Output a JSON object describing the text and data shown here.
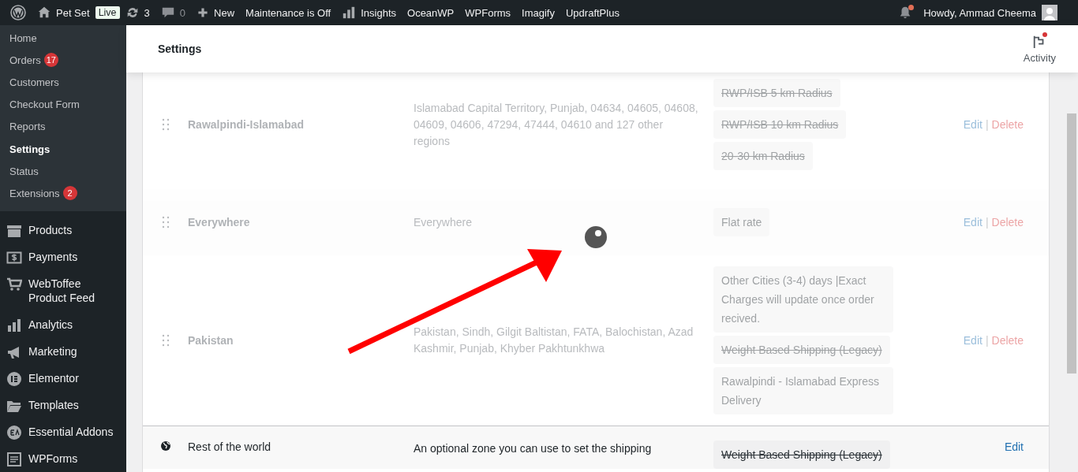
{
  "admin_bar": {
    "site": "Pet Set",
    "badge": "Live",
    "updates": "3",
    "comments": "0",
    "new": "New",
    "items": [
      "Maintenance is Off",
      "Insights",
      "OceanWP",
      "WPForms",
      "Imagify",
      "UpdraftPlus"
    ],
    "notification_dot": true,
    "greeting": "Howdy, Ammad Cheema"
  },
  "sidebar": {
    "submenu": [
      {
        "label": "Home",
        "selected": false
      },
      {
        "label": "Orders",
        "selected": false,
        "count": "17"
      },
      {
        "label": "Customers",
        "selected": false
      },
      {
        "label": "Checkout Form",
        "selected": false
      },
      {
        "label": "Reports",
        "selected": false
      },
      {
        "label": "Settings",
        "selected": true
      },
      {
        "label": "Status",
        "selected": false
      },
      {
        "label": "Extensions",
        "selected": false,
        "count": "2"
      }
    ],
    "menu": [
      "Products",
      "Payments",
      "WebToffee Product Feed",
      "Analytics",
      "Marketing",
      "Elementor",
      "Templates",
      "Essential Addons",
      "WPForms"
    ]
  },
  "header": {
    "title": "Settings",
    "activity": "Activity",
    "activity_dot": true
  },
  "zones": [
    {
      "kind": "zone",
      "name": "Rawalpindi-Islamabad",
      "dimmed": true,
      "regions": "Islamabad Capital Territory, Punjab, 04634, 04605, 04608, 04609, 04606, 47294, 47444, 04610 and 127 other regions",
      "methods": [
        {
          "label": "RWP/ISB 5 km Radius",
          "enabled": false
        },
        {
          "label": "RWP/ISB 10 km Radius",
          "enabled": false
        },
        {
          "label": "20-30 km Radius",
          "enabled": false
        }
      ],
      "actions": [
        {
          "label": "Edit",
          "kind": "edit"
        },
        {
          "label": "|",
          "kind": "separator"
        },
        {
          "label": "Delete",
          "kind": "delete"
        }
      ]
    },
    {
      "kind": "zone",
      "name": "Everywhere",
      "dimmed": true,
      "regions": "Everywhere",
      "methods": [
        {
          "label": "Flat rate",
          "enabled": true
        }
      ],
      "actions": [
        {
          "label": "Edit",
          "kind": "edit"
        },
        {
          "label": "|",
          "kind": "separator"
        },
        {
          "label": "Delete",
          "kind": "delete"
        }
      ]
    },
    {
      "kind": "zone",
      "name": "Pakistan",
      "dimmed": true,
      "regions": "Pakistan, Sindh, Gilgit Baltistan, FATA, Balochistan, Azad Kashmir, Punjab, Khyber Pakhtunkhwa",
      "methods": [
        {
          "label": "Other Cities (3-4) days |Exact Charges will update once order recived.",
          "enabled": true
        },
        {
          "label": "Weight Based Shipping (Legacy)",
          "enabled": false
        },
        {
          "label": "Rawalpindi - Islamabad Express Delivery",
          "enabled": true
        }
      ],
      "actions": [
        {
          "label": "Edit",
          "kind": "edit"
        },
        {
          "label": "|",
          "kind": "separator"
        },
        {
          "label": "Delete",
          "kind": "delete"
        }
      ]
    },
    {
      "kind": "fallback",
      "name": "Rest of the world",
      "dimmed": false,
      "regions": "An optional zone you can use to set the shipping",
      "methods": [
        {
          "label": "Weight Based Shipping (Legacy)",
          "enabled": false
        }
      ],
      "actions": [
        {
          "label": "Edit",
          "kind": "edit"
        }
      ]
    }
  ],
  "loading": true
}
